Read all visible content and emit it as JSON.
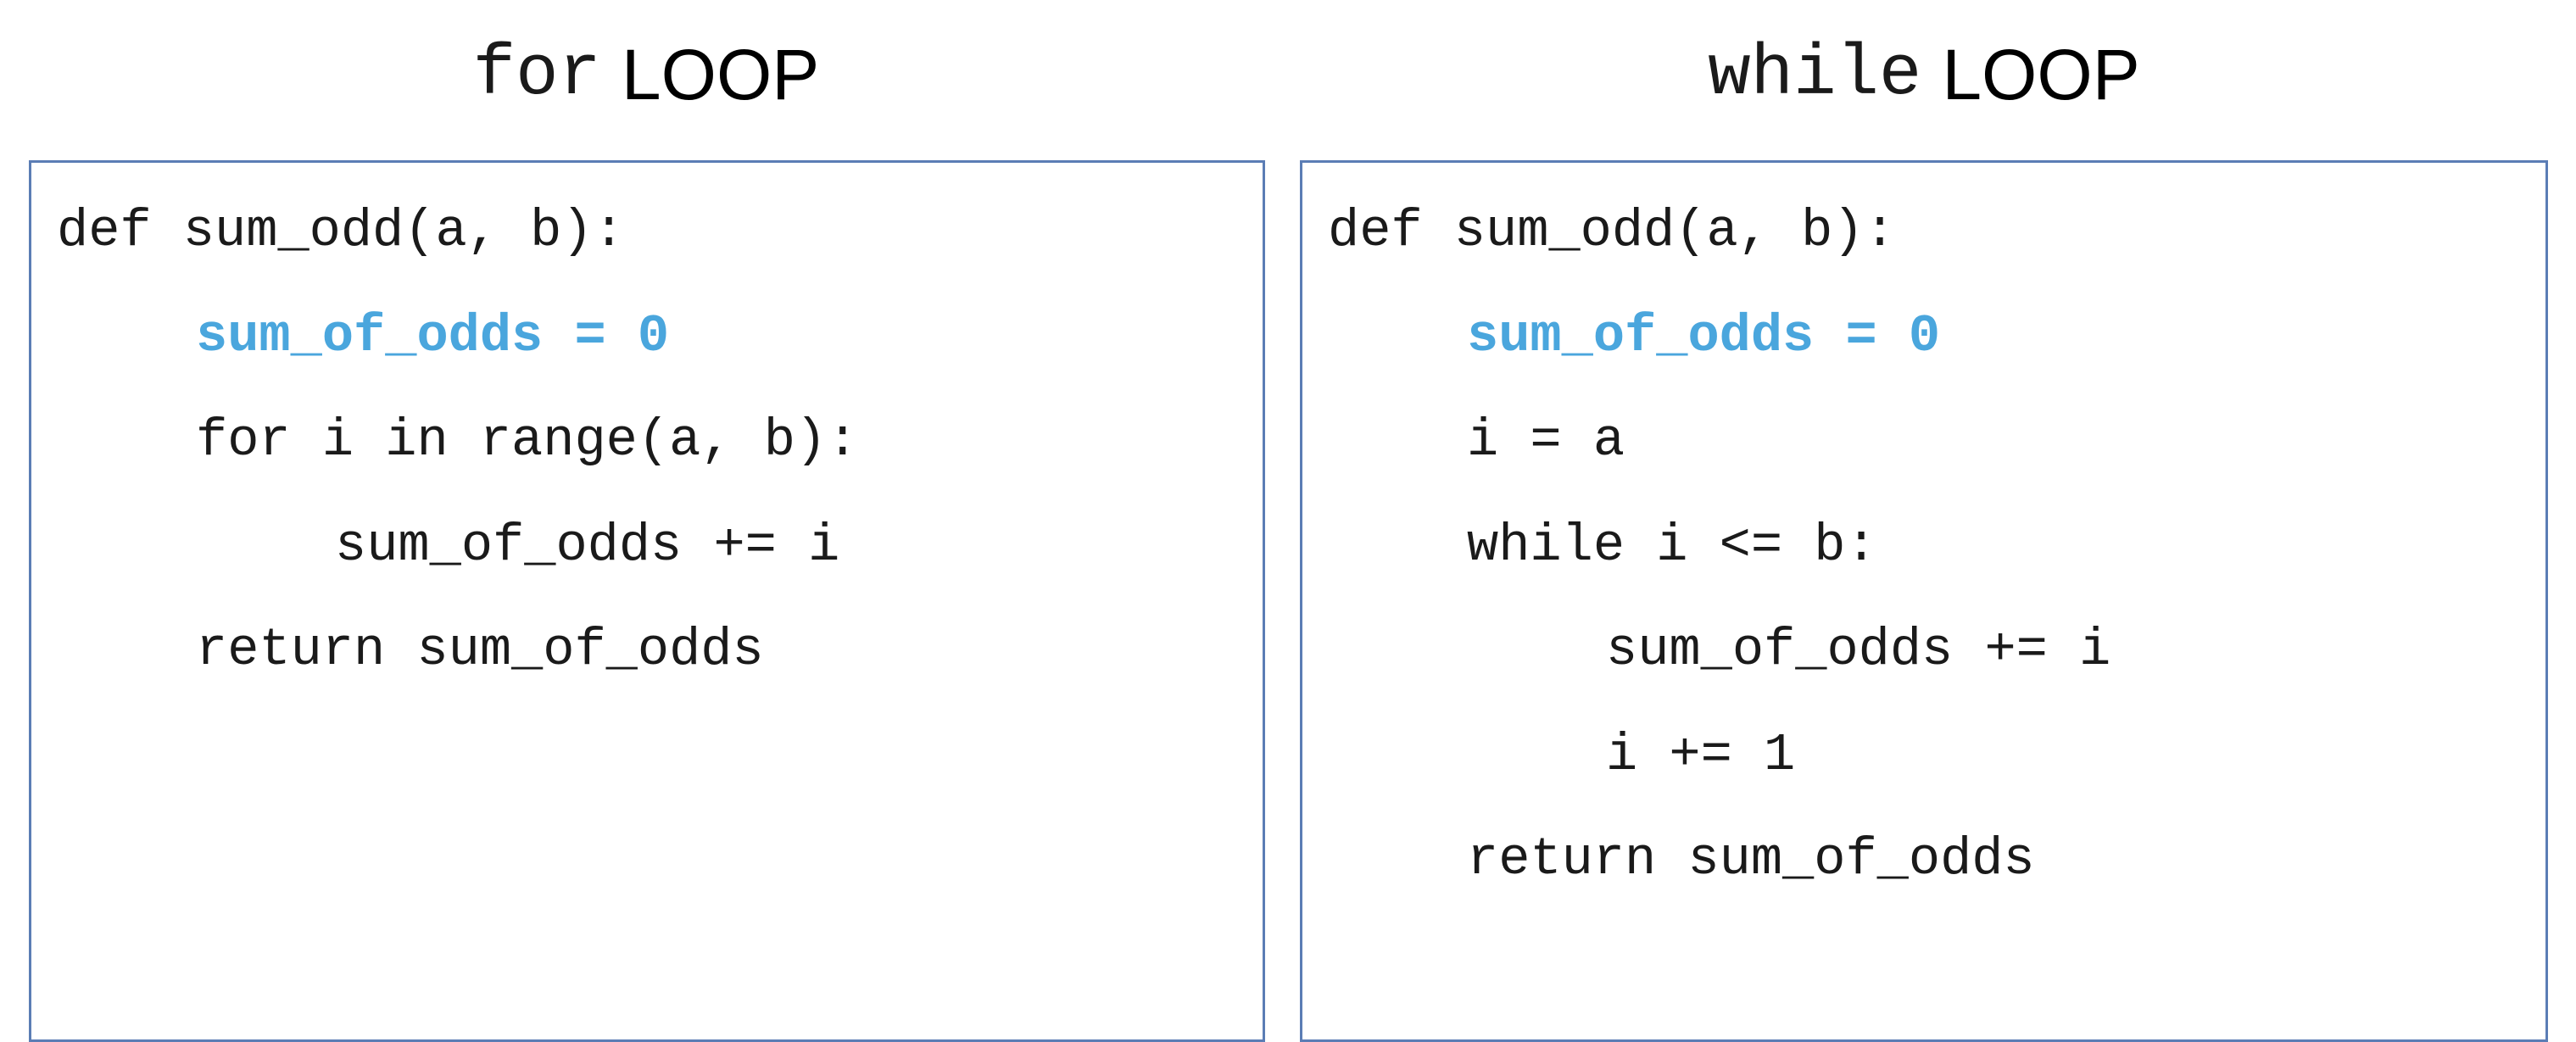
{
  "left": {
    "heading_keyword": "for",
    "heading_word": "LOOP",
    "lines": [
      "def sum_odd(a, b):",
      "sum_of_odds = 0",
      "for i in range(a, b):",
      "sum_of_odds += i",
      "return sum_of_odds"
    ]
  },
  "right": {
    "heading_keyword": "while",
    "heading_word": "LOOP",
    "lines": [
      "def sum_odd(a, b):",
      "sum_of_odds = 0",
      "i = a",
      "while i <= b:",
      "sum_of_odds += i",
      "i += 1",
      "return sum_of_odds"
    ]
  },
  "colors": {
    "highlight": "#4aa6dd",
    "panel_border": "#5b7db5",
    "text": "#1a1a1a"
  }
}
